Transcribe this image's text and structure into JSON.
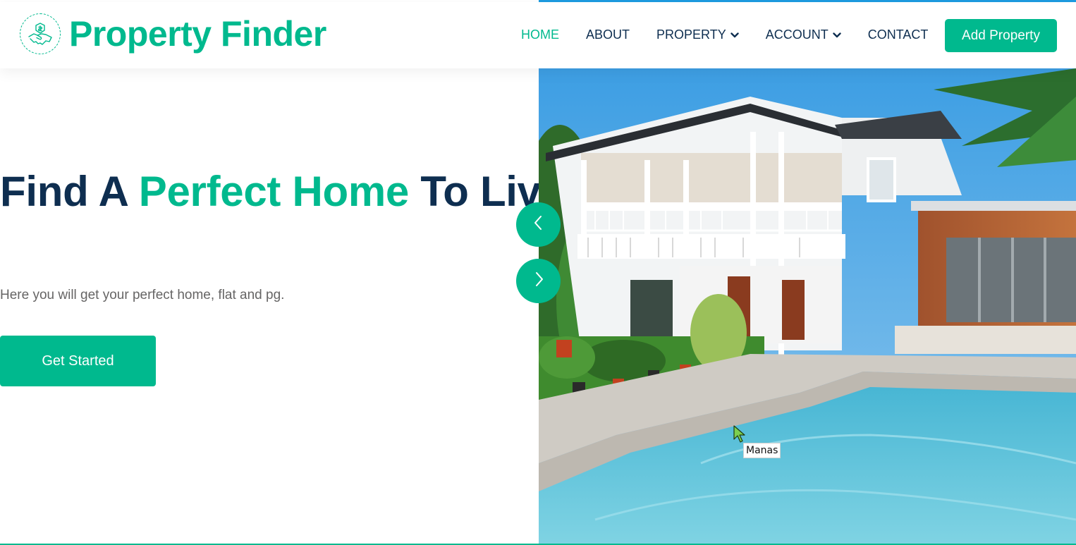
{
  "brand": {
    "name": "Property Finder",
    "logo_icon": "handshake-icon"
  },
  "nav": {
    "items": [
      {
        "label": "HOME",
        "active": true,
        "dropdown": false
      },
      {
        "label": "ABOUT",
        "active": false,
        "dropdown": false
      },
      {
        "label": "PROPERTY",
        "active": false,
        "dropdown": true
      },
      {
        "label": "ACCOUNT",
        "active": false,
        "dropdown": true
      },
      {
        "label": "CONTACT",
        "active": false,
        "dropdown": false
      }
    ],
    "cta_label": "Add Property"
  },
  "hero": {
    "title_part1": "Find A ",
    "title_highlight": "Perfect Home",
    "title_part2": " To Live With Your Family",
    "subtitle": "Here you will get your perfect home, flat and pg.",
    "button_label": "Get Started",
    "image_alt": "house-with-pool-photo"
  },
  "carousel": {
    "prev_icon": "chevron-left-icon",
    "next_icon": "chevron-right-icon"
  },
  "tooltip": {
    "text": "Manas"
  },
  "colors": {
    "accent": "#00b98e",
    "dark": "#0e2e50",
    "muted": "#666565",
    "top_bar": "#1e9be0"
  }
}
